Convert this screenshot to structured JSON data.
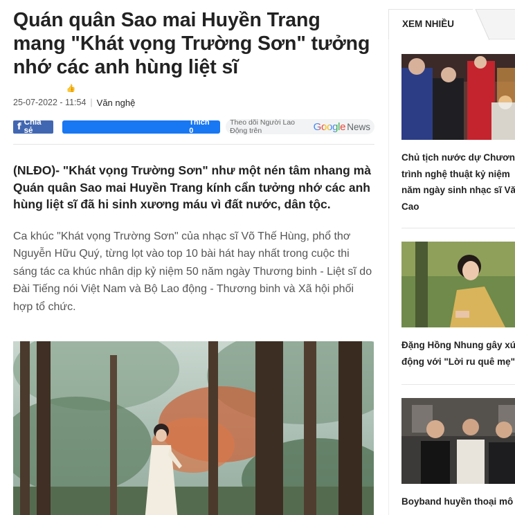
{
  "article": {
    "title": "Quán quân Sao mai Huyền Trang mang \"Khát vọng Trường Sơn\" tưởng nhớ các anh hùng liệt sĩ",
    "datetime": "25-07-2022 - 11:54",
    "separator": "|",
    "category": "Văn nghệ",
    "share_label": "Chia sẻ",
    "like_label": "Thích 0",
    "follow_text": "Theo dõi Người Lao Động trên",
    "google_news_brand": "Google",
    "google_news_suffix": "News",
    "sapo": "(NLĐO)- \"Khát vọng Trường Sơn\" như một nén tâm nhang mà Quán quân Sao mai Huyền Trang kính cẩn tưởng nhớ các anh hùng liệt sĩ đã hi sinh xương máu vì đất nước, dân tộc.",
    "body": "Ca khúc \"Khát vọng Trường Sơn\" của nhạc sĩ Võ Thế Hùng, phổ thơ Nguyễn Hữu Quý, từng lọt vào top 10 bài hát hay nhất trong cuộc thi sáng tác ca khúc nhân dịp kỷ niệm 50 năm ngày Thương binh - Liệt sĩ do Đài Tiếng nói Việt Nam và Bộ Lao động - Thương binh và Xã hội phối hợp tổ chức."
  },
  "sidebar": {
    "tab_label": "XEM NHIỀU",
    "items": [
      {
        "title_lines": [
          "Chủ tịch nước dự Chương",
          "trình nghệ thuật kỷ niệm",
          "năm ngày sinh nhạc sĩ Vă",
          "Cao"
        ]
      },
      {
        "title_lines": [
          "Đặng Hồng Nhung gây xú",
          "động với \"Lời ru quê mẹ\""
        ]
      },
      {
        "title_lines": [
          "Boyband huyền thoại mô"
        ]
      }
    ]
  },
  "colors": {
    "facebook_share": "#4267b2",
    "facebook_like": "#1877f2",
    "title_text": "#222222",
    "body_text": "#555555"
  },
  "icons": [
    "facebook-icon",
    "thumbs-up-icon",
    "google-news-logo"
  ]
}
